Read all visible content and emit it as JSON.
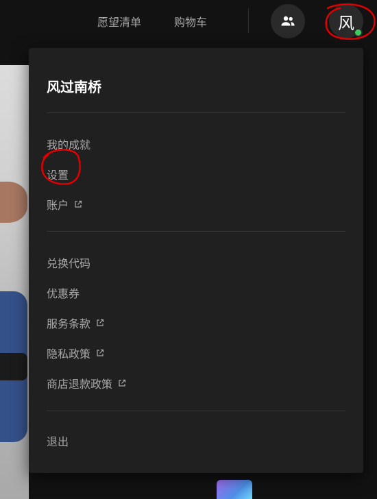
{
  "header": {
    "wishlist_label": "愿望清单",
    "cart_label": "购物车",
    "friends_icon": "friends-icon",
    "avatar_initial": "风",
    "online_status_color": "#3dc95f"
  },
  "dropdown": {
    "user_name": "风过南桥",
    "group1": [
      {
        "label": "我的成就",
        "external": false
      },
      {
        "label": "设置",
        "external": false
      },
      {
        "label": "账户",
        "external": true
      }
    ],
    "group2": [
      {
        "label": "兑换代码",
        "external": false
      },
      {
        "label": "优惠券",
        "external": false
      },
      {
        "label": "服务条款",
        "external": true
      },
      {
        "label": "隐私政策",
        "external": true
      },
      {
        "label": "商店退款政策",
        "external": true
      }
    ],
    "signout_label": "退出"
  },
  "colors": {
    "background": "#121212",
    "panel": "#202020",
    "text_primary": "#ffffff",
    "text_secondary": "#a8a8a8",
    "annotation": "#e00000"
  }
}
